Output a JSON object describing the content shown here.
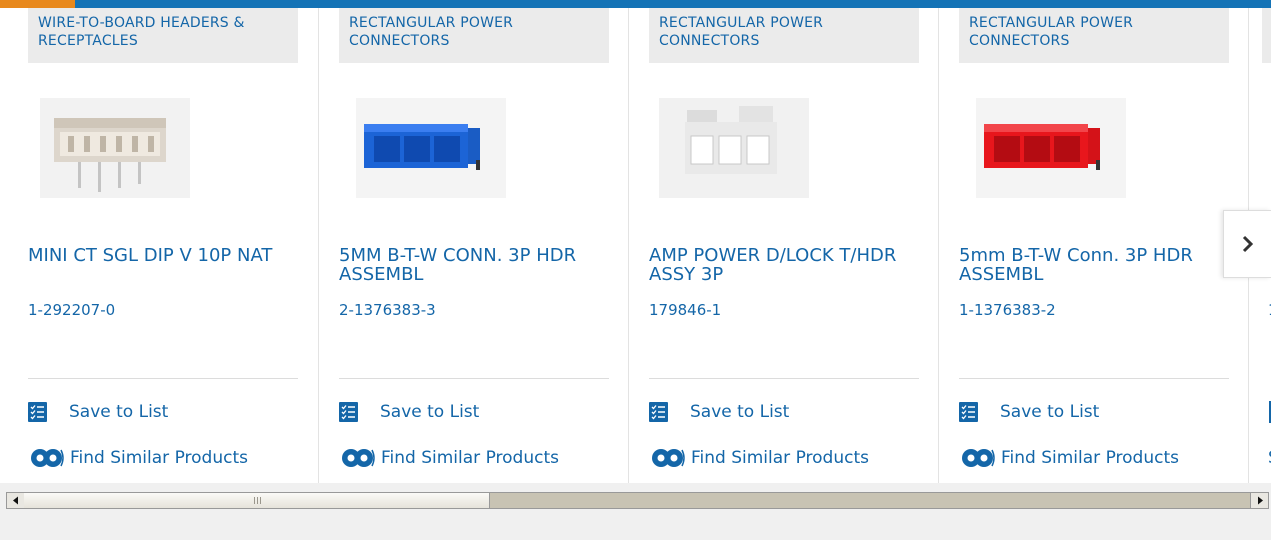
{
  "products": [
    {
      "category": "WIRE-TO-BOARD HEADERS & RECEPTACLES",
      "name": "MINI CT SGL DIP V 10P NAT",
      "part_number": "1-292207-0",
      "image": "white-wire-to-board-header",
      "save_label": "Save to List",
      "similar_label": "Find Similar Products"
    },
    {
      "category": "RECTANGULAR POWER CONNECTORS",
      "name": "5MM B-T-W CONN. 3P HDR ASSEMBL",
      "part_number": "2-1376383-3",
      "image": "blue-3-pin-connector",
      "save_label": "Save to List",
      "similar_label": "Find Similar Products"
    },
    {
      "category": "RECTANGULAR POWER CONNECTORS",
      "name": "AMP POWER D/LOCK T/HDR ASSY 3P",
      "part_number": "179846-1",
      "image": "white-3-pin-connector",
      "save_label": "Save to List",
      "similar_label": "Find Similar Products"
    },
    {
      "category": "RECTANGULAR POWER CONNECTORS",
      "name": "5mm B-T-W Conn. 3P HDR ASSEMBL",
      "part_number": "1-1376383-2",
      "image": "red-3-pin-connector",
      "save_label": "Save to List",
      "similar_label": "Find Similar Products"
    }
  ],
  "partial_card": {
    "part_number_glyph": "1",
    "save_glyph": "S"
  },
  "colors": {
    "brand_blue": "#1466a8",
    "accent_orange": "#e8891d",
    "category_bg": "#ebebeb"
  },
  "icons": {
    "save": "checklist-icon",
    "similar": "gear-pair-icon",
    "next": "chevron-right-icon"
  }
}
